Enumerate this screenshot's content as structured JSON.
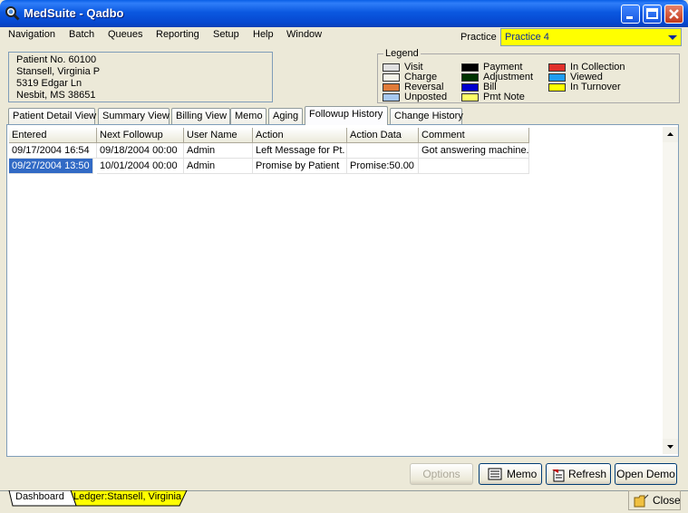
{
  "window": {
    "title": "MedSuite - Qadbo"
  },
  "menu": [
    "Navigation",
    "Batch",
    "Queues",
    "Reporting",
    "Setup",
    "Help",
    "Window"
  ],
  "practice": {
    "label": "Practice",
    "value": "Practice 4"
  },
  "patient": {
    "number": "Patient No. 60100",
    "name": "Stansell, Virginia P",
    "address1": "5319 Edgar Ln",
    "address2": "Nesbit, MS 38651"
  },
  "legend": {
    "title": "Legend",
    "items": [
      {
        "label": "Visit",
        "color": "#e0e0e0"
      },
      {
        "label": "Charge",
        "color": "#f4f3e8"
      },
      {
        "label": "Reversal",
        "color": "#e07b39"
      },
      {
        "label": "Unposted",
        "color": "#a6c8f0"
      },
      {
        "label": "Payment",
        "color": "#000000"
      },
      {
        "label": "Adjustment",
        "color": "#003300"
      },
      {
        "label": "Bill",
        "color": "#0000cc"
      },
      {
        "label": "Pmt Note",
        "color": "#ffff66"
      },
      {
        "label": "In Collection",
        "color": "#e0302a"
      },
      {
        "label": "Viewed",
        "color": "#1f9cf0"
      },
      {
        "label": "In Turnover",
        "color": "#ffff00"
      }
    ]
  },
  "tabs": [
    "Patient Detail View",
    "Summary View",
    "Billing View",
    "Memo",
    "Aging",
    "Followup History",
    "Change History"
  ],
  "active_tab": "Followup History",
  "grid": {
    "columns": [
      "Entered",
      "Next Followup",
      "User Name",
      "Action",
      "Action Data",
      "Comment"
    ],
    "rows": [
      [
        "09/17/2004 16:54",
        "09/18/2004 00:00",
        "Admin",
        "Left Message for Pt.",
        "",
        "Got answering machine."
      ],
      [
        "09/27/2004 13:50",
        "10/01/2004 00:00",
        "Admin",
        "Promise by Patient",
        "Promise:50.00",
        ""
      ]
    ]
  },
  "buttons": {
    "options": "Options",
    "memo": "Memo",
    "refresh": "Refresh",
    "open_demo": "Open Demo",
    "close": "Close"
  },
  "doc_tabs": {
    "dashboard": "Dashboard",
    "ledger": "Ledger:Stansell, Virginia"
  }
}
